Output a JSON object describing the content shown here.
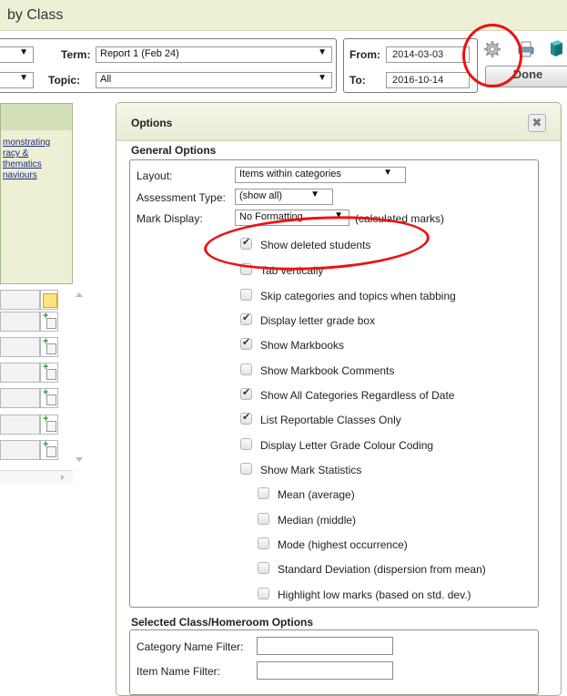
{
  "title_bar": {
    "text": "by Class"
  },
  "filters": {
    "term_label": "Term:",
    "term_value": "Report 1 (Feb 24)",
    "topic_label": "Topic:",
    "topic_value": "All",
    "from_label": "From:",
    "from_value": "2014-03-03",
    "to_label": "To:",
    "to_value": "2016-10-14",
    "done_label": "Done"
  },
  "left_panel": {
    "links": [
      "monstrating",
      "racy &",
      "thematics",
      "naviours"
    ]
  },
  "options_dialog": {
    "title": "Options",
    "close_glyph": "✖",
    "general_heading": "General Options",
    "layout_label": "Layout:",
    "layout_value": "Items within categories",
    "assessment_label": "Assessment Type:",
    "assessment_value": "(show all)",
    "mark_display_label": "Mark Display:",
    "mark_display_value": "No Formatting",
    "mark_display_note": "(calculated marks)",
    "checkboxes": [
      {
        "label": "Show deleted students",
        "checked": true
      },
      {
        "label": "Tab vertically",
        "checked": false
      },
      {
        "label": "Skip categories and topics when tabbing",
        "checked": false
      },
      {
        "label": "Display letter grade box",
        "checked": true
      },
      {
        "label": "Show Markbooks",
        "checked": true
      },
      {
        "label": "Show Markbook Comments",
        "checked": false
      },
      {
        "label": "Show All Categories Regardless of Date",
        "checked": true
      },
      {
        "label": "List Reportable Classes Only",
        "checked": true
      },
      {
        "label": "Display Letter Grade Colour Coding",
        "checked": false
      },
      {
        "label": "Show Mark Statistics",
        "checked": false
      }
    ],
    "stat_checkboxes": [
      {
        "label": "Mean (average)",
        "checked": false
      },
      {
        "label": "Median (middle)",
        "checked": false
      },
      {
        "label": "Mode (highest occurrence)",
        "checked": false
      },
      {
        "label": "Standard Deviation (dispersion from mean)",
        "checked": false
      },
      {
        "label": "Highlight low marks (based on std. dev.)",
        "checked": false
      }
    ],
    "selected_heading": "Selected Class/Homeroom Options",
    "category_filter_label": "Category Name Filter:",
    "item_filter_label": "Item Name Filter:"
  },
  "colors": {
    "header_bg": "#eef0d6",
    "annotation_red": "#ee1111"
  }
}
